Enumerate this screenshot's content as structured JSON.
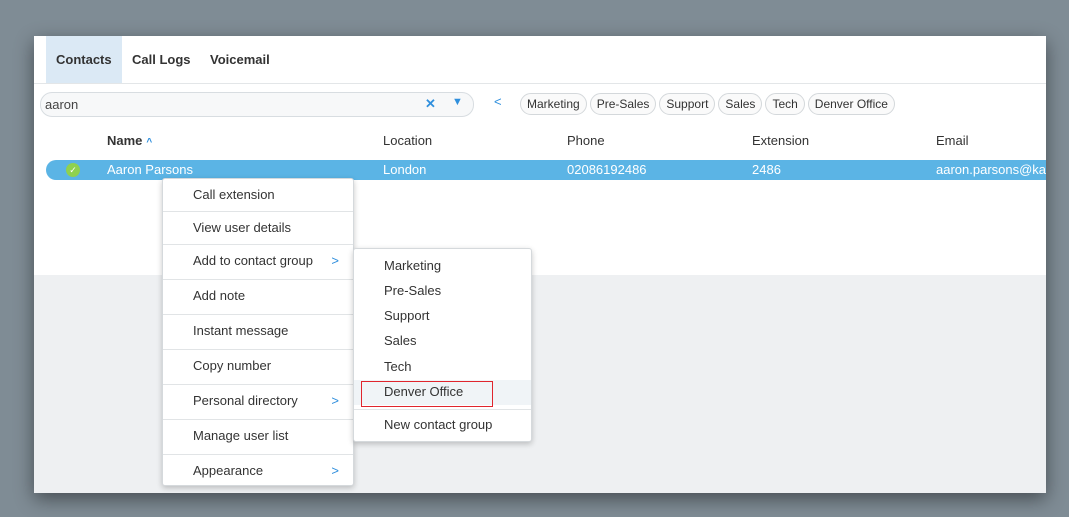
{
  "tabs": [
    {
      "label": "Contacts",
      "active": true
    },
    {
      "label": "Call Logs",
      "active": false
    },
    {
      "label": "Voicemail",
      "active": false
    }
  ],
  "search": {
    "value": "aaron",
    "clear_icon": "✕",
    "dropdown_icon": "▼"
  },
  "prev_icon": "<",
  "filter_chips": [
    "Marketing",
    "Pre-Sales",
    "Support",
    "Sales",
    "Tech",
    "Denver Office"
  ],
  "table": {
    "columns": [
      "Name",
      "Location",
      "Phone",
      "Extension",
      "Email"
    ],
    "sort_icon": "^",
    "rows": [
      {
        "selected": true,
        "check_icon": "✓",
        "name": "Aaron Parsons",
        "location": "London",
        "phone": "02086192486",
        "extension": "2486",
        "email": "aaron.parsons@ka"
      }
    ]
  },
  "context_menu": {
    "arrow_icon": ">",
    "items": [
      {
        "label": "Call extension",
        "submenu": false
      },
      {
        "label": "View user details",
        "submenu": false
      },
      {
        "label": "Add to contact group",
        "submenu": true
      },
      {
        "label": "Add note",
        "submenu": false
      },
      {
        "label": "Instant message",
        "submenu": false
      },
      {
        "label": "Copy number",
        "submenu": false
      },
      {
        "label": "Personal directory",
        "submenu": true
      },
      {
        "label": "Manage user list",
        "submenu": false
      },
      {
        "label": "Appearance",
        "submenu": true
      }
    ]
  },
  "submenu": {
    "items": [
      "Marketing",
      "Pre-Sales",
      "Support",
      "Sales",
      "Tech",
      "Denver Office"
    ],
    "new_group": "New contact group",
    "highlighted": "Denver Office"
  },
  "colors": {
    "accent": "#2f8fdd",
    "selected_row": "#5bb4e5",
    "active_tab": "#dbe9f5",
    "highlight_border": "#e0252d",
    "check": "#8fd14f"
  }
}
